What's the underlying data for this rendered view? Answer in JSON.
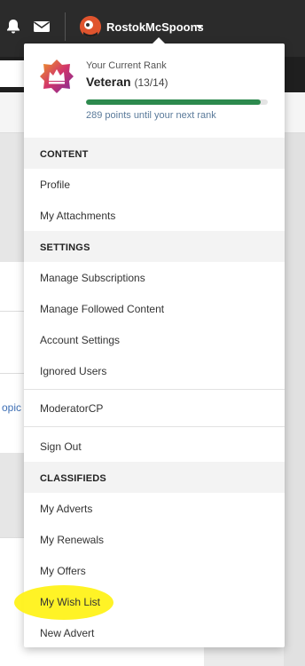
{
  "topbar": {
    "username": "RostokMcSpoons"
  },
  "background": {
    "topic_text": "opic"
  },
  "rank": {
    "label": "Your Current Rank",
    "name": "Veteran",
    "progress_text": "(13/14)",
    "progress_fraction": 0.96,
    "until_text": "289 points until your next rank",
    "bar_color": "#2d8a4e"
  },
  "menu": {
    "content_header": "CONTENT",
    "profile": "Profile",
    "attachments": "My Attachments",
    "settings_header": "SETTINGS",
    "subscriptions": "Manage Subscriptions",
    "followed": "Manage Followed Content",
    "account": "Account Settings",
    "ignored": "Ignored Users",
    "moderator": "ModeratorCP",
    "signout": "Sign Out",
    "classifieds_header": "CLASSIFIEDS",
    "adverts": "My Adverts",
    "renewals": "My Renewals",
    "offers": "My Offers",
    "wishlist": "My Wish List",
    "new_advert": "New Advert"
  },
  "colors": {
    "highlight": "#fff21a",
    "topbar": "#2b2b2b"
  },
  "icons": [
    "bell-icon",
    "mail-icon",
    "rank-crown-icon",
    "chevron-down-icon"
  ]
}
